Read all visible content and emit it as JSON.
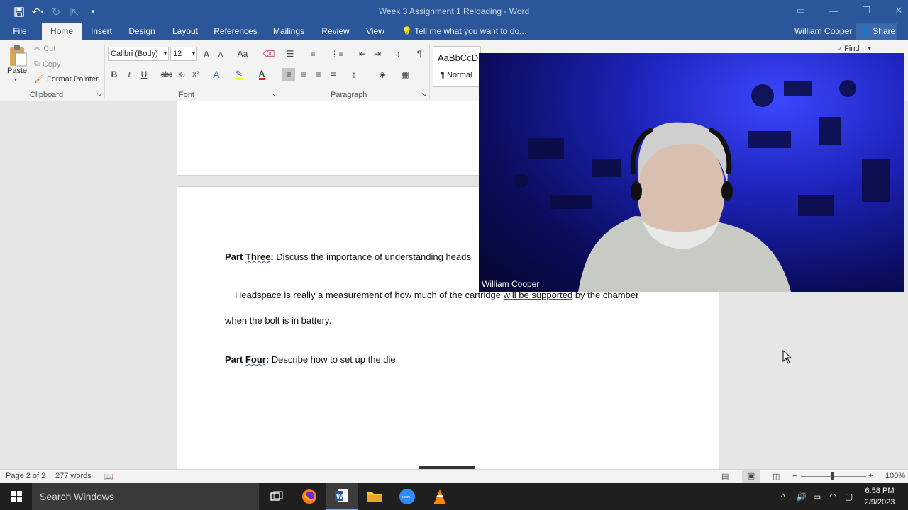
{
  "window": {
    "title": "Week 3 Assignment 1  Reloading - Word"
  },
  "tabs": [
    "File",
    "Home",
    "Insert",
    "Design",
    "Layout",
    "References",
    "Mailings",
    "Review",
    "View"
  ],
  "tell_me": "Tell me what you want to do...",
  "user": "William Cooper",
  "share_label": "Share",
  "clipboard": {
    "paste": "Paste",
    "cut": "Cut",
    "copy": "Copy",
    "format_painter": "Format Painter",
    "group_label": "Clipboard"
  },
  "font": {
    "name": "Calibri (Body)",
    "size": "12",
    "group_label": "Font",
    "bold": "B",
    "italic": "I",
    "underline": "U",
    "strike": "abc",
    "subscript": "x₂",
    "superscript": "x²",
    "grow": "A",
    "shrink": "A",
    "change_case": "Aa"
  },
  "paragraph": {
    "group_label": "Paragraph"
  },
  "styles": {
    "preview": "AaBbCcD",
    "name": "¶ Normal"
  },
  "editing": {
    "find": "Find"
  },
  "document": {
    "part_three_label": "Part ",
    "part_three_word": "Three",
    "part_three_colon": ":",
    "part_three_text": " Discuss the importance of understanding heads",
    "answer_line1_a": "Headspace is really a measurement of how much of the cartridge ",
    "answer_line1_b": "will be supported",
    "answer_line1_c": " by the chamber",
    "answer_line2": "when the bolt is in battery.",
    "part_four_label": "Part ",
    "part_four_word": "Four",
    "part_four_colon": ":",
    "part_four_text": " Describe how to set up the die."
  },
  "webcam": {
    "name": "William Cooper"
  },
  "status": {
    "page": "Page 2 of 2",
    "words": "277 words",
    "zoom": "100%"
  },
  "taskbar": {
    "search_placeholder": "Search Windows",
    "apps": [
      "task-view",
      "firefox",
      "word",
      "file-explorer",
      "zoom",
      "vlc"
    ]
  },
  "clock": {
    "time": "6:58 PM",
    "date": "2/9/2023"
  },
  "colors": {
    "word_blue": "#2b579a",
    "ribbon": "#f3f3f3",
    "taskbar": "#1f1f1f"
  }
}
